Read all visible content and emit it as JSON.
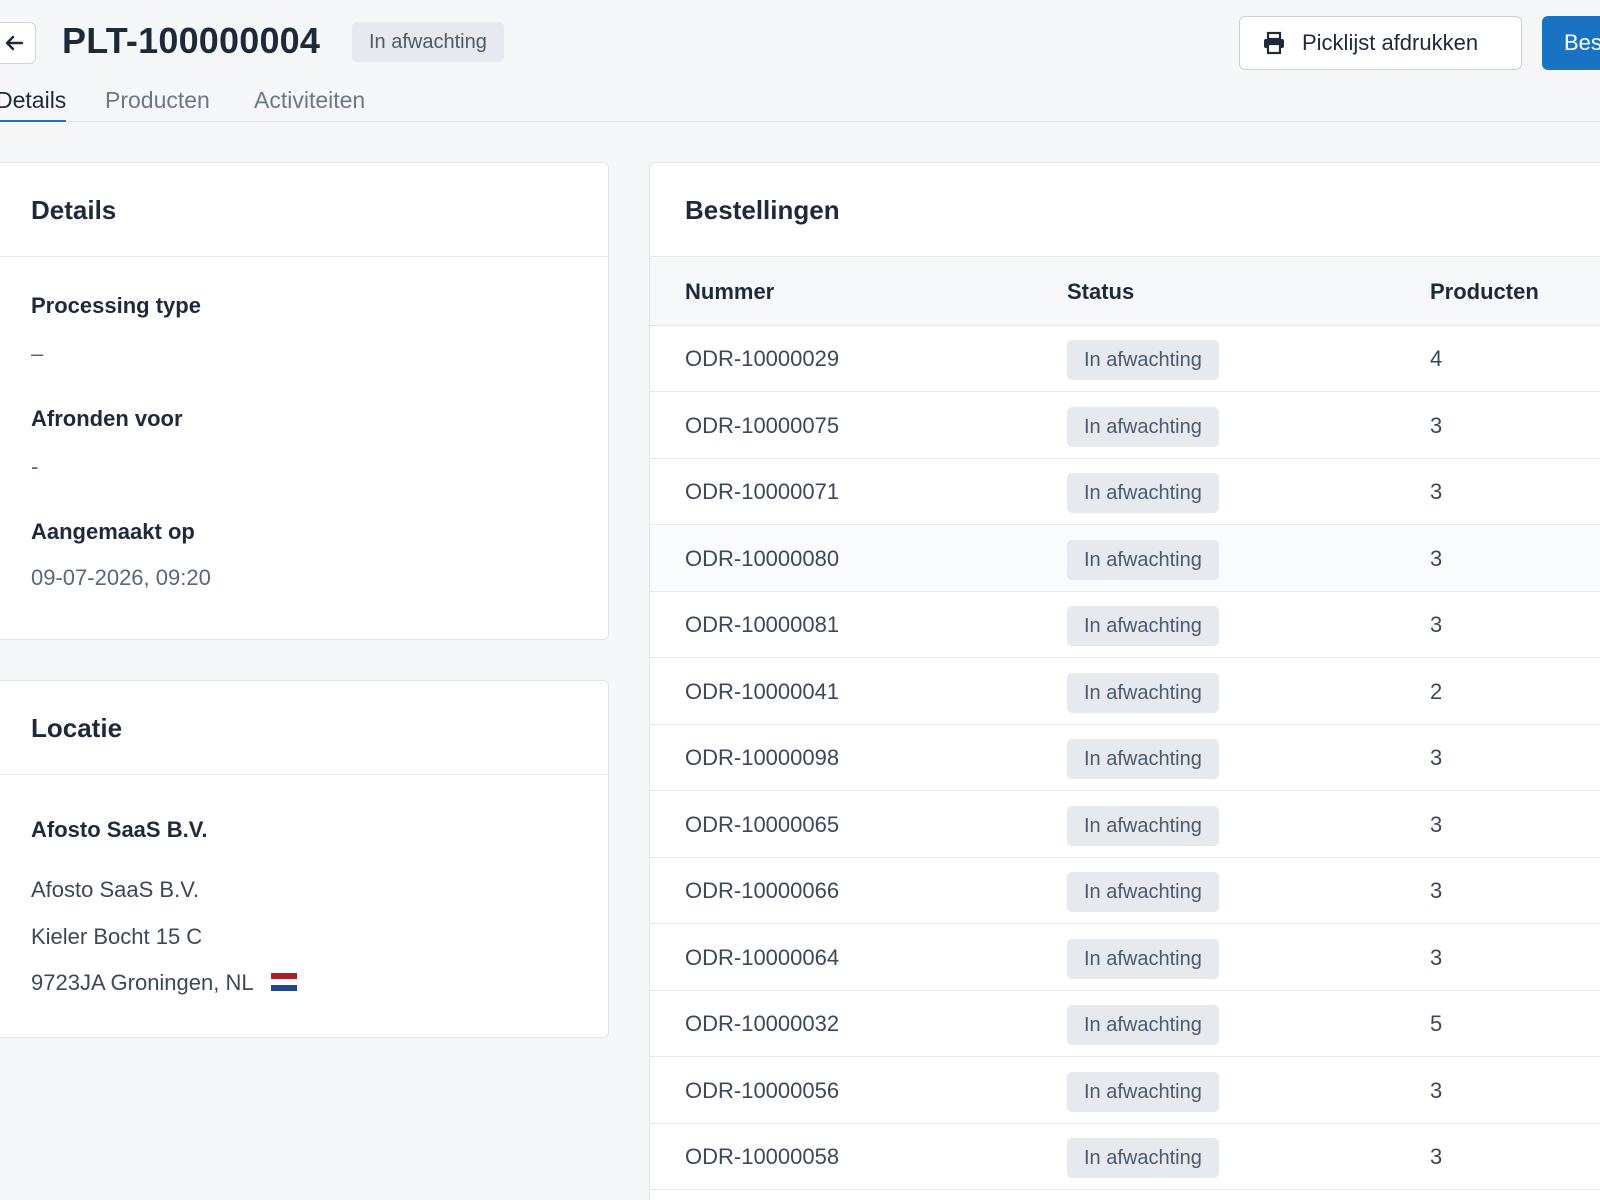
{
  "header": {
    "title": "PLT-100000004",
    "status_badge": "In afwachting",
    "print_button_label": "Picklijst afdrukken",
    "primary_button_label": "Bes"
  },
  "tabs": [
    {
      "label": "Details",
      "active": true
    },
    {
      "label": "Producten",
      "active": false
    },
    {
      "label": "Activiteiten",
      "active": false
    }
  ],
  "details": {
    "heading": "Details",
    "fields": [
      {
        "label": "Processing type",
        "value": "–"
      },
      {
        "label": "Afronden voor",
        "value": "-"
      },
      {
        "label": "Aangemaakt op",
        "value": "09-07-2026, 09:20"
      }
    ]
  },
  "locatie": {
    "heading": "Locatie",
    "name": "Afosto SaaS B.V.",
    "lines": [
      "Afosto SaaS B.V.",
      "Kieler Bocht 15 C",
      "9723JA Groningen, NL"
    ],
    "flag_colors": [
      "#ae1c28",
      "#ffffff",
      "#21468b"
    ]
  },
  "orders": {
    "heading": "Bestellingen",
    "columns": [
      "Nummer",
      "Status",
      "Producten"
    ],
    "rows": [
      {
        "number": "ODR-10000029",
        "status": "In afwachting",
        "products": "4"
      },
      {
        "number": "ODR-10000075",
        "status": "In afwachting",
        "products": "3"
      },
      {
        "number": "ODR-10000071",
        "status": "In afwachting",
        "products": "3"
      },
      {
        "number": "ODR-10000080",
        "status": "In afwachting",
        "products": "3"
      },
      {
        "number": "ODR-10000081",
        "status": "In afwachting",
        "products": "3"
      },
      {
        "number": "ODR-10000041",
        "status": "In afwachting",
        "products": "2"
      },
      {
        "number": "ODR-10000098",
        "status": "In afwachting",
        "products": "3"
      },
      {
        "number": "ODR-10000065",
        "status": "In afwachting",
        "products": "3"
      },
      {
        "number": "ODR-10000066",
        "status": "In afwachting",
        "products": "3"
      },
      {
        "number": "ODR-10000064",
        "status": "In afwachting",
        "products": "3"
      },
      {
        "number": "ODR-10000032",
        "status": "In afwachting",
        "products": "5"
      },
      {
        "number": "ODR-10000056",
        "status": "In afwachting",
        "products": "3"
      },
      {
        "number": "ODR-10000058",
        "status": "In afwachting",
        "products": "3"
      }
    ]
  },
  "colors": {
    "accent": "#1a73c2",
    "badge_bg": "#e6e9ee",
    "page_bg": "#f6f7f9"
  }
}
